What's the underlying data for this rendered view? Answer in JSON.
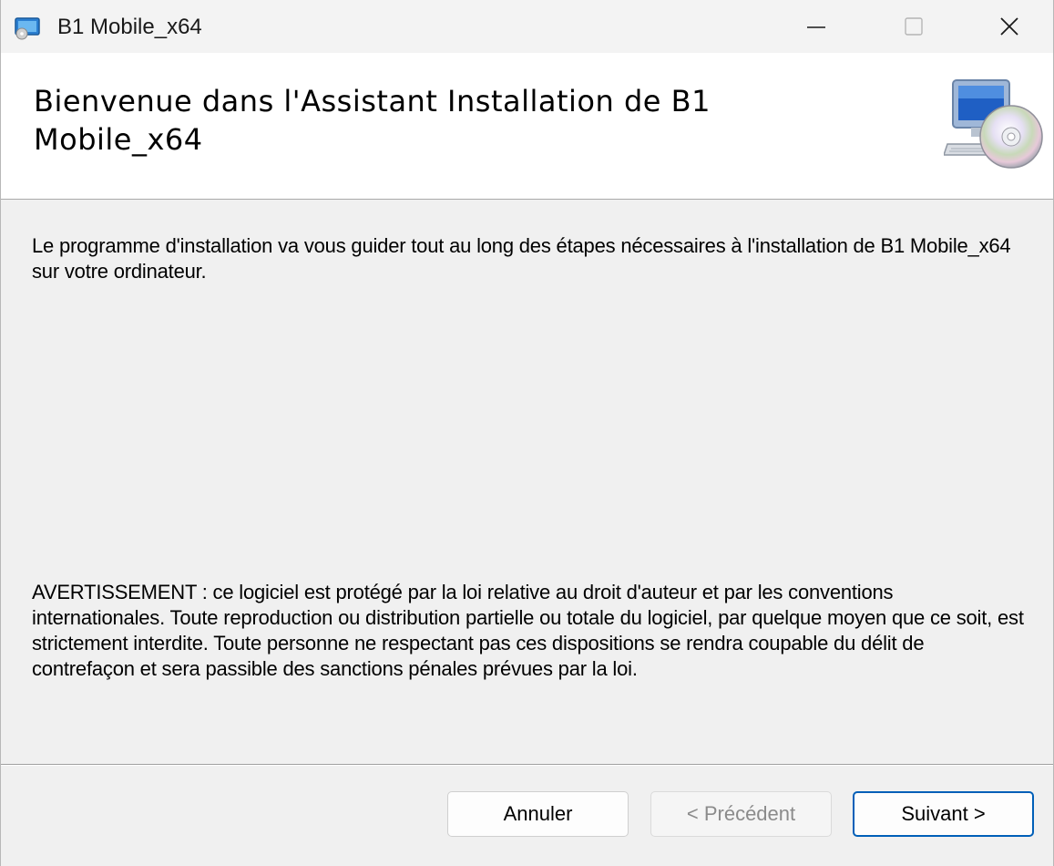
{
  "window": {
    "title": "B1 Mobile_x64",
    "app_icon": "installer-icon",
    "controls": {
      "minimize_icon": "minimize-icon",
      "maximize_icon": "maximize-icon",
      "close_icon": "close-icon"
    }
  },
  "header": {
    "title": "Bienvenue dans l'Assistant Installation de B1 Mobile_x64",
    "icon": "computer-cd-icon"
  },
  "body": {
    "intro": "Le programme d'installation va vous guider tout au long des étapes nécessaires à l'installation de B1 Mobile_x64 sur votre ordinateur.",
    "warning": "AVERTISSEMENT : ce logiciel est protégé par la loi relative au droit d'auteur et par les conventions internationales. Toute reproduction ou distribution partielle ou totale du logiciel, par quelque moyen que ce soit, est strictement interdite. Toute personne ne respectant pas ces dispositions se rendra coupable du délit de contrefaçon et sera passible des sanctions pénales prévues par la loi."
  },
  "buttons": {
    "cancel": "Annuler",
    "previous": "< Précédent",
    "previous_enabled": false,
    "next": "Suivant >"
  },
  "colors": {
    "accent": "#005fb8",
    "header_bg": "#ffffff",
    "body_bg": "#f0f0f0"
  }
}
